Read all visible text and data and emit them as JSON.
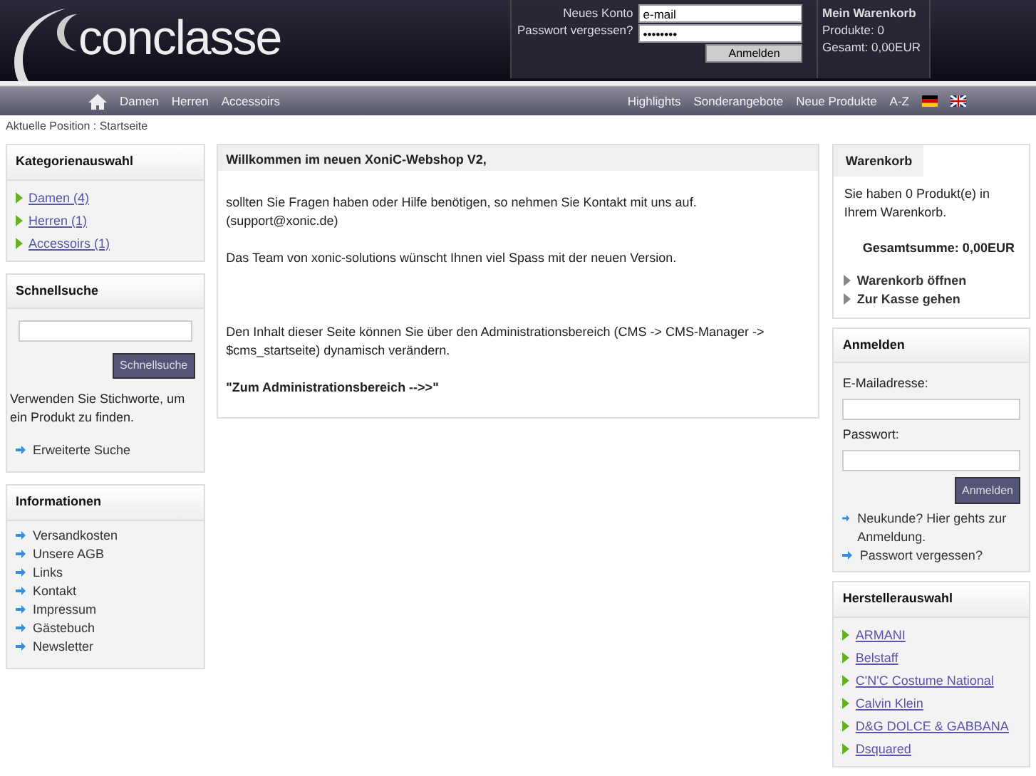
{
  "logo": {
    "text": "conclasse"
  },
  "login": {
    "links": [
      "Neues Konto",
      "Passwort vergessen?"
    ],
    "email": {
      "value": "e-mail"
    },
    "password": {
      "value": "••••••••"
    },
    "button": "Anmelden"
  },
  "mini_cart": {
    "title": "Mein Warenkorb",
    "lines": [
      "Produkte: 0",
      "Gesamt: 0,00EUR"
    ]
  },
  "nav": {
    "left": [
      "Damen",
      "Herren",
      "Accessoirs"
    ],
    "right": [
      "Highlights",
      "Sonderangebote",
      "Neue Produkte",
      "A-Z"
    ],
    "flags": [
      {
        "kind": "de"
      },
      {
        "kind": "uk"
      }
    ]
  },
  "breadcrumb": "Aktuelle Position : Startseite",
  "categories": {
    "title": "Kategorienauswahl",
    "items": [
      "Damen (4)",
      "Herren (1)",
      "Accessoirs (1)"
    ]
  },
  "quick_search": {
    "title": "Schnellsuche",
    "button": "Schnellsuche",
    "hint": "Verwenden Sie Stichworte, um ein Produkt zu finden.",
    "link": "Erweiterte Suche"
  },
  "information": {
    "title": "Informationen",
    "items": [
      "Versandkosten",
      "Unsere AGB",
      "Links",
      "Kontakt",
      "Impressum",
      "Gästebuch",
      "Newsletter"
    ]
  },
  "content": {
    "title": "Willkommen im neuen XoniC-Webshop V2,",
    "paragraphs": [
      {
        "kind": "text",
        "text": "sollten Sie Fragen haben oder Hilfe benötigen, so nehmen Sie Kontakt mit uns auf. (support@xonic.de)"
      },
      {
        "kind": "text",
        "text": "Das Team von xonic-solutions wünscht Ihnen viel Spass mit der neuen Version."
      },
      {
        "kind": "spacer"
      },
      {
        "kind": "text",
        "text": "Den Inhalt dieser Seite können Sie über den Administrationsbereich (CMS -> CMS-Manager -> $cms_startseite) dynamisch verändern."
      },
      {
        "kind": "link",
        "text": "\"Zum Administrationsbereich -->>\""
      }
    ]
  },
  "cart": {
    "title": "Warenkorb",
    "text": "Sie haben 0 Produkt(e) in Ihrem Warenkorb.",
    "total": "Gesamtsumme: 0,00EUR",
    "links": [
      "Warenkorb öffnen",
      "Zur Kasse gehen"
    ]
  },
  "signin": {
    "title": "Anmelden",
    "email_label": "E-Mailadresse:",
    "password_label": "Passwort:",
    "button": "Anmelden",
    "links": [
      "Neukunde? Hier gehts zur Anmeldung.",
      "Passwort vergessen?"
    ]
  },
  "manufacturers": {
    "title": "Herstellerauswahl",
    "items": [
      "ARMANI",
      "Belstaff",
      "C'N'C Costume National",
      "Calvin Klein",
      "D&G DOLCE & GABBANA",
      "Dsquared"
    ]
  }
}
